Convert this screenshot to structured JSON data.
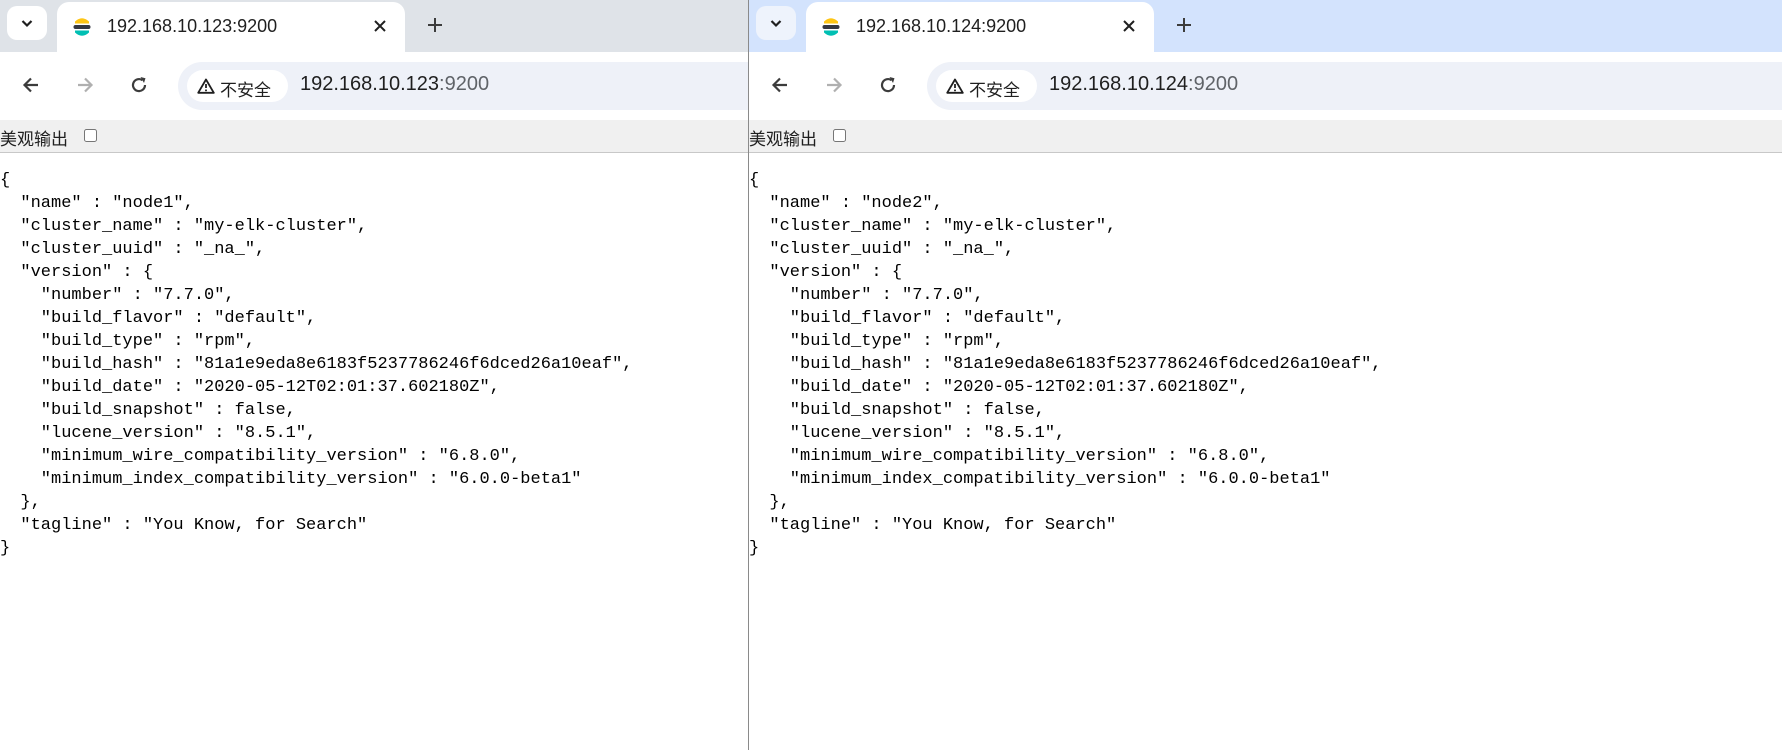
{
  "windows": [
    {
      "tab_title": "192.168.10.123:9200",
      "security_label": "不安全",
      "url_host": "192.168.10.123",
      "url_port": ":9200",
      "pretty_print_label": "美观输出",
      "json_lines": [
        "{",
        "  \"name\" : \"node1\",",
        "  \"cluster_name\" : \"my-elk-cluster\",",
        "  \"cluster_uuid\" : \"_na_\",",
        "  \"version\" : {",
        "    \"number\" : \"7.7.0\",",
        "    \"build_flavor\" : \"default\",",
        "    \"build_type\" : \"rpm\",",
        "    \"build_hash\" : \"81a1e9eda8e6183f5237786246f6dced26a10eaf\",",
        "    \"build_date\" : \"2020-05-12T02:01:37.602180Z\",",
        "    \"build_snapshot\" : false,",
        "    \"lucene_version\" : \"8.5.1\",",
        "    \"minimum_wire_compatibility_version\" : \"6.8.0\",",
        "    \"minimum_index_compatibility_version\" : \"6.0.0-beta1\"",
        "  },",
        "  \"tagline\" : \"You Know, for Search\"",
        "}"
      ]
    },
    {
      "tab_title": "192.168.10.124:9200",
      "security_label": "不安全",
      "url_host": "192.168.10.124",
      "url_port": ":9200",
      "pretty_print_label": "美观输出",
      "json_lines": [
        "{",
        "  \"name\" : \"node2\",",
        "  \"cluster_name\" : \"my-elk-cluster\",",
        "  \"cluster_uuid\" : \"_na_\",",
        "  \"version\" : {",
        "    \"number\" : \"7.7.0\",",
        "    \"build_flavor\" : \"default\",",
        "    \"build_type\" : \"rpm\",",
        "    \"build_hash\" : \"81a1e9eda8e6183f5237786246f6dced26a10eaf\",",
        "    \"build_date\" : \"2020-05-12T02:01:37.602180Z\",",
        "    \"build_snapshot\" : false,",
        "    \"lucene_version\" : \"8.5.1\",",
        "    \"minimum_wire_compatibility_version\" : \"6.8.0\",",
        "    \"minimum_index_compatibility_version\" : \"6.0.0-beta1\"",
        "  },",
        "  \"tagline\" : \"You Know, for Search\"",
        "}"
      ]
    }
  ],
  "icons": {
    "tab_menu": "chevron-down-icon",
    "favicon": "elasticsearch-icon",
    "close": "close-icon",
    "new_tab": "plus-icon",
    "back": "arrow-left-icon",
    "forward": "arrow-right-icon",
    "reload": "reload-icon",
    "security": "warning-icon"
  },
  "colors": {
    "left_tabstrip": "#dfe3e8",
    "right_tabstrip": "#d3e3fd",
    "omnibox": "#eef1f8",
    "favicon_yellow": "#fec514",
    "favicon_teal": "#00bfb3",
    "favicon_dark": "#343741"
  }
}
